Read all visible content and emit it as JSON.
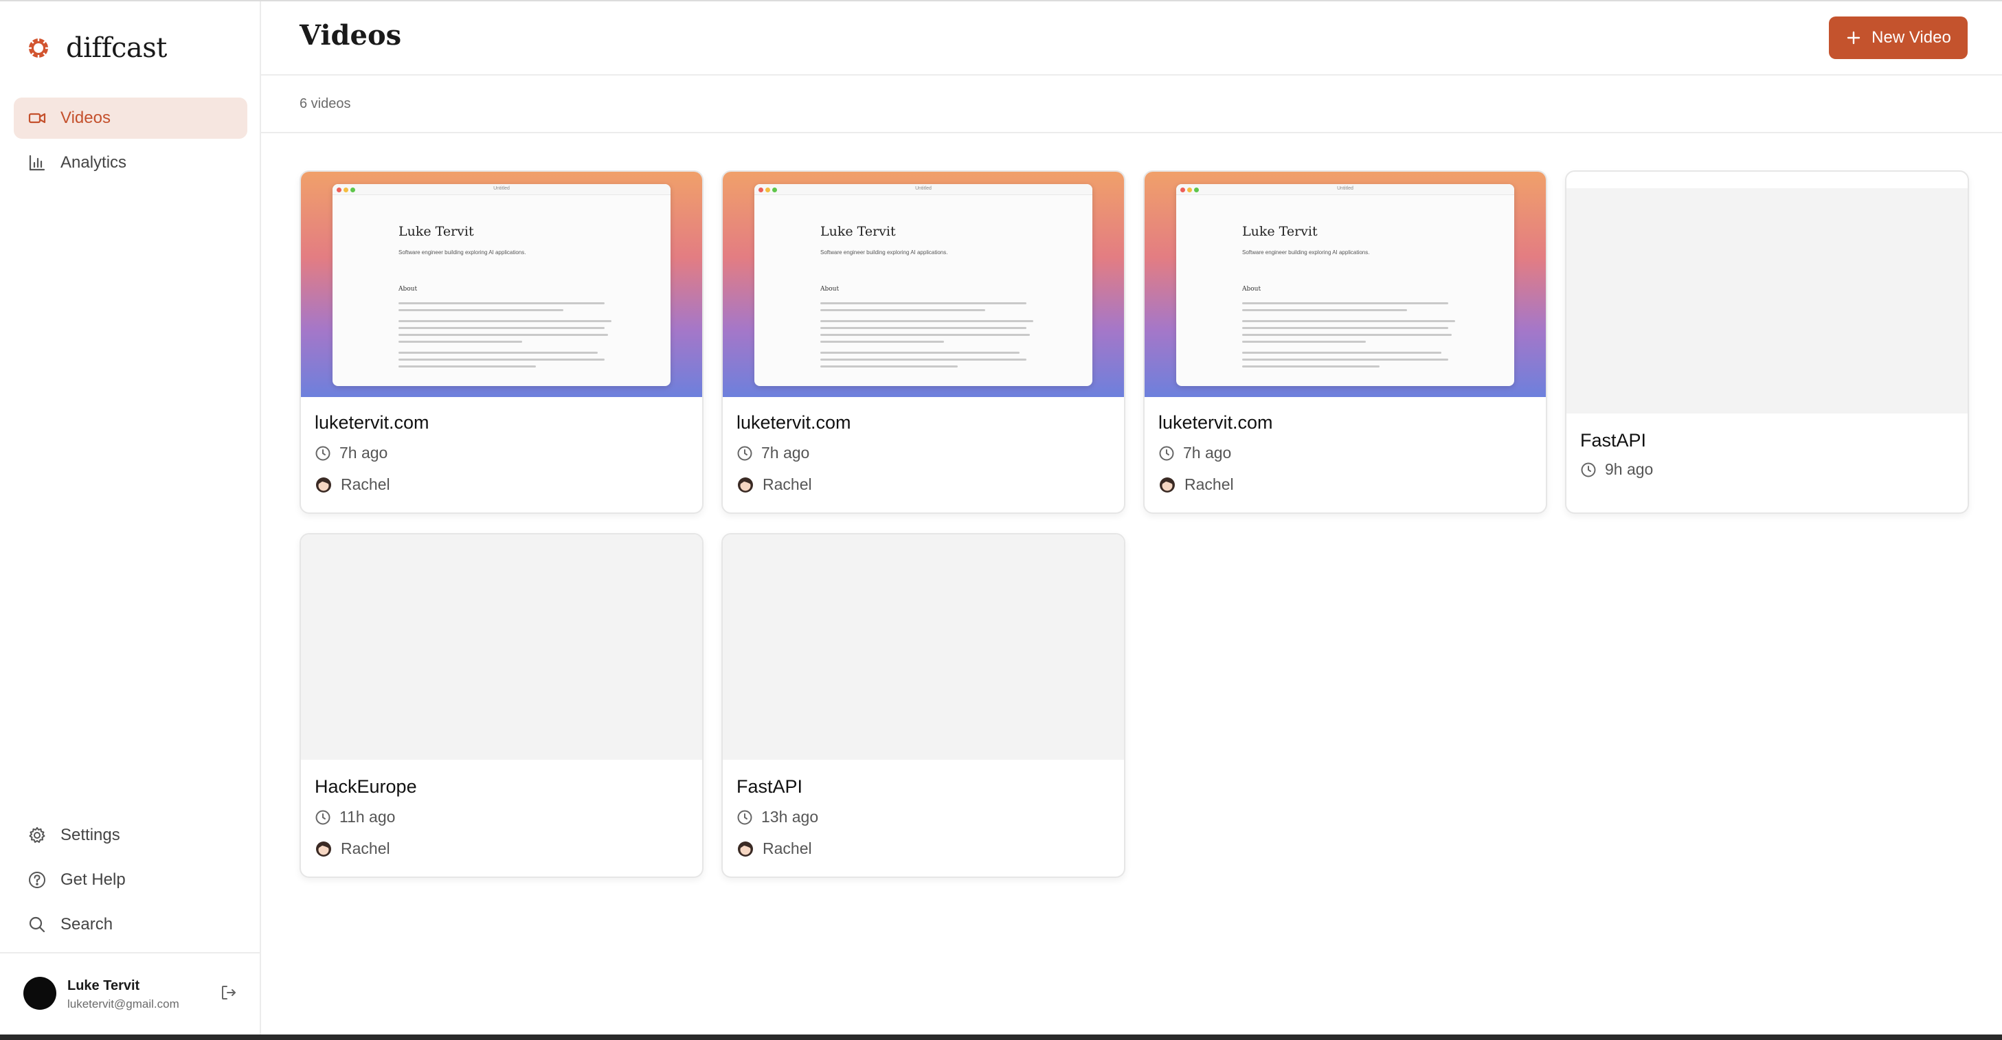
{
  "brand": {
    "name": "diffcast",
    "accent": "#c4532d"
  },
  "nav": [
    {
      "label": "Videos",
      "icon": "video-icon",
      "active": true
    },
    {
      "label": "Analytics",
      "icon": "bar-chart-icon",
      "active": false
    }
  ],
  "bottom_nav": [
    {
      "label": "Settings",
      "icon": "gear-icon"
    },
    {
      "label": "Get Help",
      "icon": "help-circle-icon"
    },
    {
      "label": "Search",
      "icon": "search-icon"
    }
  ],
  "user": {
    "name": "Luke Tervit",
    "email": "luketervit@gmail.com"
  },
  "header": {
    "title": "Videos",
    "new_button_label": "New Video"
  },
  "video_count": "6 videos",
  "thumbnail_page": {
    "tab_title": "Untitled",
    "name": "Luke Tervit",
    "tagline": "Software engineer building exploring AI applications.",
    "section": "About"
  },
  "videos": [
    {
      "title": "luketervit.com",
      "time": "7h ago",
      "author": "Rachel",
      "has_thumbnail": true
    },
    {
      "title": "luketervit.com",
      "time": "7h ago",
      "author": "Rachel",
      "has_thumbnail": true
    },
    {
      "title": "luketervit.com",
      "time": "7h ago",
      "author": "Rachel",
      "has_thumbnail": true
    },
    {
      "title": "FastAPI",
      "time": "9h ago",
      "author": "",
      "has_thumbnail": false
    },
    {
      "title": "HackEurope",
      "time": "11h ago",
      "author": "Rachel",
      "has_thumbnail": false
    },
    {
      "title": "FastAPI",
      "time": "13h ago",
      "author": "Rachel",
      "has_thumbnail": false
    }
  ]
}
